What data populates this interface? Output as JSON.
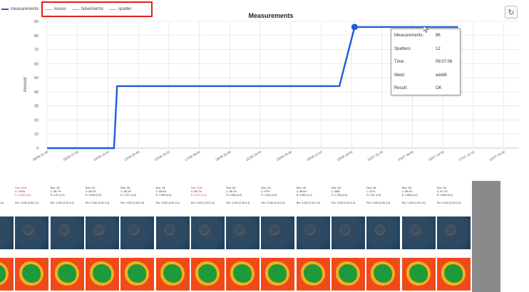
{
  "legend": [
    {
      "label": "measurements",
      "color": "#1f5bd8",
      "width": 2
    },
    {
      "label": "issues",
      "color": "#b0b0b0",
      "width": 1
    },
    {
      "label": "falseAlarms",
      "color": "#b0b0b0",
      "width": 1
    },
    {
      "label": "spatter",
      "color": "#b0b0b0",
      "width": 1
    }
  ],
  "refresh_icon": "refresh-icon",
  "chart_data": {
    "type": "line",
    "title": "Measurements",
    "ylabel": "Amount",
    "xlabel": "",
    "ylim": [
      0,
      90
    ],
    "yticks": [
      0,
      10,
      20,
      30,
      40,
      50,
      60,
      70,
      80,
      90
    ],
    "grid": true,
    "legend_position": "top-left",
    "xticks": [
      "09/06 01:00",
      "09/06 07:30",
      "10/06 14:10",
      "13/06 20:40",
      "15/06 03:20",
      "17/06 09:50",
      "19/06 16:30",
      "21/06 23:00",
      "24/06 05:40",
      "26/06 12:10",
      "28/06 18:50",
      "01/07 01:20",
      "03/07 08:00",
      "05/07 14:30",
      "07/07 21:10",
      "10/07 03:40"
    ],
    "series": [
      {
        "name": "measurements",
        "color": "#1f5bd8",
        "points": [
          [
            0,
            0
          ],
          [
            2.2,
            0
          ],
          [
            2.3,
            44
          ],
          [
            9.6,
            44
          ],
          [
            10.1,
            86
          ],
          [
            13.5,
            86
          ]
        ]
      }
    ]
  },
  "tooltip": {
    "rows": [
      {
        "key": "Measurements:",
        "value": "86"
      },
      {
        "key": "Spatters:",
        "value": "12"
      },
      {
        "key": "Time:",
        "value": "09:07:06"
      },
      {
        "key": "Weld:",
        "value": "weld6"
      },
      {
        "key": "Result:",
        "value": "OK"
      }
    ]
  },
  "cards": [
    {
      "res": "Res: OK",
      "bad": false,
      "c": "C: 86.2%",
      "d": "D: 4.750 (4.0)",
      "rm": "Rm: 3.200 (2.50-3.4)"
    },
    {
      "res": "Res: NOK",
      "bad": true,
      "c": "C: 100%",
      "d": "D: 4.200 (4.0)",
      "rm": "Rm: 3.200 (2.50-3.4)"
    },
    {
      "res": "Res: OK",
      "bad": false,
      "c": "C: 88.7%",
      "d": "D: 4.87 (4.0)",
      "rm": "Rm: 3.200 (2.50-3.4)"
    },
    {
      "res": "Res: OK",
      "bad": false,
      "c": "C: 88.1%",
      "d": "D: 4.558 (4.0)",
      "rm": "Rm: 3.200 (2.50-3.4)"
    },
    {
      "res": "Res: OK",
      "bad": false,
      "c": "C: 88.2%",
      "d": "D: 4.572 (4.0)",
      "rm": "Rm: 3.200 (2.50-3.4)"
    },
    {
      "res": "Res: OK",
      "bad": false,
      "c": "C: 88.6%",
      "d": "D: 4.559 (4.0)",
      "rm": "Rm: 3.200 (2.50-3.4)"
    },
    {
      "res": "Res: NOK",
      "bad": true,
      "c": "C: 88.7%",
      "d": "D: 4.227 (4.0)",
      "rm": "Rm: 3.200 (2.50-3.4)"
    },
    {
      "res": "Res: OK",
      "bad": false,
      "c": "C: 88.7%",
      "d": "D: 4.655 (4.0)",
      "rm": "Rm: 3.200 (2.50-3.4)"
    },
    {
      "res": "Res: OK",
      "bad": false,
      "c": "C: 87%",
      "d": "D: 4.814 (4.0)",
      "rm": "Rm: 3.200 (2.50-3.4)"
    },
    {
      "res": "Res: OK",
      "bad": false,
      "c": "C: 88.8%",
      "d": "D: 4.609 (4.0)",
      "rm": "Rm: 3.200 (2.50-3.4)"
    },
    {
      "res": "Res: OK",
      "bad": false,
      "c": "C: 88%",
      "d": "D: 4.756 (4.0)",
      "rm": "Rm: 3.200 (2.50-3.4)"
    },
    {
      "res": "Res: OK",
      "bad": false,
      "c": "C: 87%",
      "d": "D: 4.87 (4.0)",
      "rm": "Rm: 3.200 (2.50-3.4)"
    },
    {
      "res": "Res: OK",
      "bad": false,
      "c": "C: 88.4%",
      "d": "D: 4.665 (4.0)",
      "rm": "Rm: 3.200 (2.50-3.4)"
    },
    {
      "res": "Res: OK",
      "bad": false,
      "c": "C: 87.7%",
      "d": "D: 4.659 (4.0)",
      "rm": "Rm: 3.200 (2.50-3.4)"
    }
  ]
}
